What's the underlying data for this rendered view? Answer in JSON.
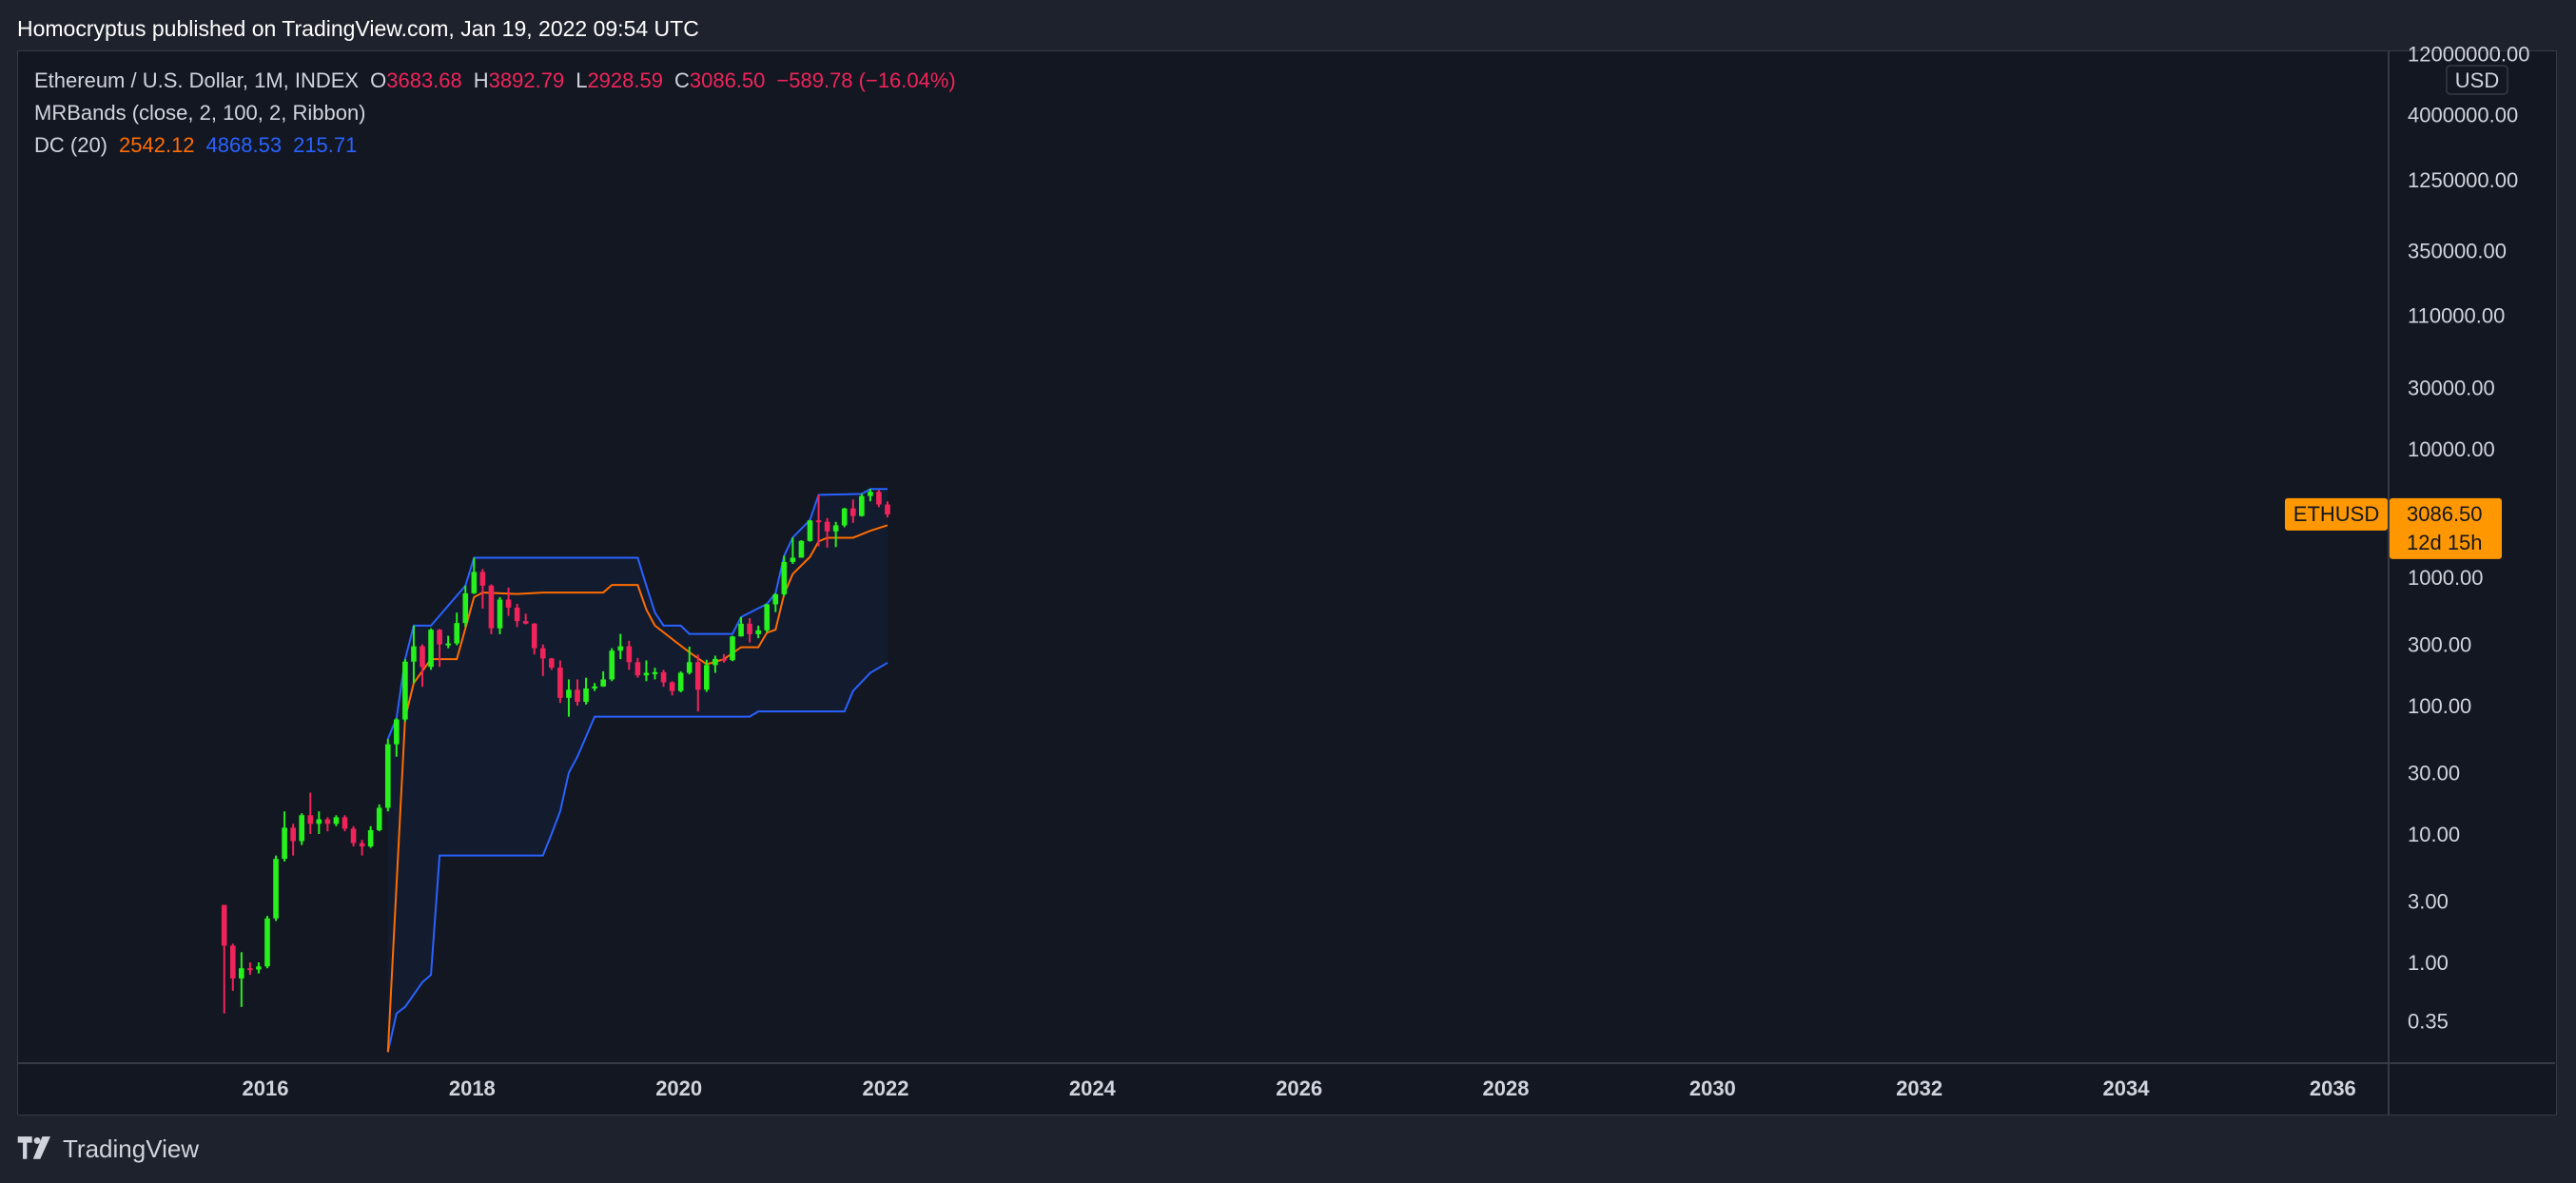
{
  "header": {
    "published": "Homocryptus published on TradingView.com, Jan 19, 2022 09:54 UTC"
  },
  "legend": {
    "symbol": "Ethereum / U.S. Dollar, 1M, INDEX",
    "o_label": "O",
    "o_value": "3683.68",
    "h_label": "H",
    "h_value": "3892.79",
    "l_label": "L",
    "l_value": "2928.59",
    "c_label": "C",
    "c_value": "3086.50",
    "change": "−589.78 (−16.04%)",
    "mrbands": "MRBands (close, 2, 100, 2, Ribbon)",
    "dc_label": "DC (20)",
    "dc_basis": "2542.12",
    "dc_upper": "4868.53",
    "dc_lower": "215.71"
  },
  "price_tag": {
    "symbol": "ETHUSD",
    "price": "3086.50",
    "countdown": "12d 15h"
  },
  "currency": "USD",
  "footer": {
    "brand": "TradingView"
  },
  "colors": {
    "up": "#26f11d",
    "down": "#f0245a",
    "dc_upper_lower": "#2962ff",
    "dc_basis": "#ff6d00",
    "mr_band": "#9c27b0",
    "tag": "#ff9800",
    "bg": "#131722"
  },
  "chart_data": {
    "type": "candlestick",
    "scale": "log",
    "ylim": [
      0.2,
      15000000
    ],
    "xlim": [
      "2014-01-01",
      "2037-01-01"
    ],
    "y_ticks": [
      "12000000.00",
      "4000000.00",
      "1250000.00",
      "350000.00",
      "110000.00",
      "30000.00",
      "10000.00",
      "1000.00",
      "300.00",
      "100.00",
      "30.00",
      "10.00",
      "3.00",
      "1.00",
      "0.35"
    ],
    "y_tick_values": [
      12000000,
      4000000,
      1250000,
      350000,
      110000,
      30000,
      10000,
      1000,
      300,
      100,
      30,
      10,
      3,
      1,
      0.35
    ],
    "x_ticks": [
      "2016",
      "2018",
      "2020",
      "2022",
      "2024",
      "2026",
      "2028",
      "2030",
      "2032",
      "2034",
      "2036"
    ],
    "candles": [
      {
        "t": "2015-08",
        "o": 2.8,
        "h": 2.8,
        "l": 0.4,
        "c": 1.35
      },
      {
        "t": "2015-09",
        "o": 1.35,
        "h": 1.4,
        "l": 0.6,
        "c": 0.75
      },
      {
        "t": "2015-10",
        "o": 0.75,
        "h": 1.2,
        "l": 0.45,
        "c": 0.9
      },
      {
        "t": "2015-11",
        "o": 0.9,
        "h": 1.0,
        "l": 0.8,
        "c": 0.88
      },
      {
        "t": "2015-12",
        "o": 0.88,
        "h": 1.0,
        "l": 0.82,
        "c": 0.93
      },
      {
        "t": "2016-01",
        "o": 0.93,
        "h": 2.3,
        "l": 0.9,
        "c": 2.2
      },
      {
        "t": "2016-02",
        "o": 2.2,
        "h": 6.8,
        "l": 2.1,
        "c": 6.4
      },
      {
        "t": "2016-03",
        "o": 6.4,
        "h": 15.0,
        "l": 6.1,
        "c": 11.2
      },
      {
        "t": "2016-04",
        "o": 11.2,
        "h": 12.0,
        "l": 6.8,
        "c": 8.8
      },
      {
        "t": "2016-05",
        "o": 8.8,
        "h": 14.5,
        "l": 8.2,
        "c": 14.0
      },
      {
        "t": "2016-06",
        "o": 14.0,
        "h": 21.0,
        "l": 10.0,
        "c": 12.0
      },
      {
        "t": "2016-07",
        "o": 12.0,
        "h": 15.0,
        "l": 10.0,
        "c": 13.0
      },
      {
        "t": "2016-08",
        "o": 13.0,
        "h": 13.5,
        "l": 10.5,
        "c": 12.0
      },
      {
        "t": "2016-09",
        "o": 12.0,
        "h": 14.0,
        "l": 11.5,
        "c": 13.5
      },
      {
        "t": "2016-10",
        "o": 13.5,
        "h": 14.0,
        "l": 10.5,
        "c": 11.0
      },
      {
        "t": "2016-11",
        "o": 11.0,
        "h": 11.5,
        "l": 8.0,
        "c": 8.5
      },
      {
        "t": "2016-12",
        "o": 8.5,
        "h": 9.0,
        "l": 6.8,
        "c": 8.0
      },
      {
        "t": "2017-01",
        "o": 8.0,
        "h": 11.5,
        "l": 7.8,
        "c": 10.7
      },
      {
        "t": "2017-02",
        "o": 10.7,
        "h": 17.0,
        "l": 10.5,
        "c": 16.0
      },
      {
        "t": "2017-03",
        "o": 16.0,
        "h": 55.0,
        "l": 15.0,
        "c": 50.0
      },
      {
        "t": "2017-04",
        "o": 50.0,
        "h": 80.0,
        "l": 40.0,
        "c": 78.0
      },
      {
        "t": "2017-05",
        "o": 78.0,
        "h": 230.0,
        "l": 75.0,
        "c": 220.0
      },
      {
        "t": "2017-06",
        "o": 220.0,
        "h": 420.0,
        "l": 150.0,
        "c": 290.0
      },
      {
        "t": "2017-07",
        "o": 290.0,
        "h": 300.0,
        "l": 140.0,
        "c": 200.0
      },
      {
        "t": "2017-08",
        "o": 200.0,
        "h": 400.0,
        "l": 190.0,
        "c": 390.0
      },
      {
        "t": "2017-09",
        "o": 390.0,
        "h": 395.0,
        "l": 200.0,
        "c": 300.0
      },
      {
        "t": "2017-10",
        "o": 300.0,
        "h": 350.0,
        "l": 280.0,
        "c": 305.0
      },
      {
        "t": "2017-11",
        "o": 305.0,
        "h": 530.0,
        "l": 295.0,
        "c": 440.0
      },
      {
        "t": "2017-12",
        "o": 440.0,
        "h": 860.0,
        "l": 410.0,
        "c": 750.0
      },
      {
        "t": "2018-01",
        "o": 750.0,
        "h": 1420.0,
        "l": 740.0,
        "c": 1100.0
      },
      {
        "t": "2018-02",
        "o": 1100.0,
        "h": 1160.0,
        "l": 570.0,
        "c": 860.0
      },
      {
        "t": "2018-03",
        "o": 860.0,
        "h": 880.0,
        "l": 360.0,
        "c": 400.0
      },
      {
        "t": "2018-04",
        "o": 400.0,
        "h": 700.0,
        "l": 360.0,
        "c": 670.0
      },
      {
        "t": "2018-05",
        "o": 670.0,
        "h": 830.0,
        "l": 500.0,
        "c": 580.0
      },
      {
        "t": "2018-06",
        "o": 580.0,
        "h": 620.0,
        "l": 410.0,
        "c": 455.0
      },
      {
        "t": "2018-07",
        "o": 455.0,
        "h": 520.0,
        "l": 430.0,
        "c": 435.0
      },
      {
        "t": "2018-08",
        "o": 435.0,
        "h": 440.0,
        "l": 250.0,
        "c": 280.0
      },
      {
        "t": "2018-09",
        "o": 280.0,
        "h": 300.0,
        "l": 170.0,
        "c": 233.0
      },
      {
        "t": "2018-10",
        "o": 233.0,
        "h": 235.0,
        "l": 190.0,
        "c": 198.0
      },
      {
        "t": "2018-11",
        "o": 198.0,
        "h": 225.0,
        "l": 105.0,
        "c": 115.0
      },
      {
        "t": "2018-12",
        "o": 115.0,
        "h": 160.0,
        "l": 82.0,
        "c": 133.0
      },
      {
        "t": "2019-01",
        "o": 133.0,
        "h": 160.0,
        "l": 100.0,
        "c": 107.0
      },
      {
        "t": "2019-02",
        "o": 107.0,
        "h": 165.0,
        "l": 102.0,
        "c": 136.0
      },
      {
        "t": "2019-03",
        "o": 136.0,
        "h": 150.0,
        "l": 130.0,
        "c": 141.0
      },
      {
        "t": "2019-04",
        "o": 141.0,
        "h": 185.0,
        "l": 140.0,
        "c": 160.0
      },
      {
        "t": "2019-05",
        "o": 160.0,
        "h": 280.0,
        "l": 155.0,
        "c": 268.0
      },
      {
        "t": "2019-06",
        "o": 268.0,
        "h": 362.0,
        "l": 230.0,
        "c": 290.0
      },
      {
        "t": "2019-07",
        "o": 290.0,
        "h": 320.0,
        "l": 190.0,
        "c": 218.0
      },
      {
        "t": "2019-08",
        "o": 218.0,
        "h": 235.0,
        "l": 165.0,
        "c": 172.0
      },
      {
        "t": "2019-09",
        "o": 172.0,
        "h": 225.0,
        "l": 155.0,
        "c": 180.0
      },
      {
        "t": "2019-10",
        "o": 180.0,
        "h": 197.0,
        "l": 160.0,
        "c": 182.0
      },
      {
        "t": "2019-11",
        "o": 182.0,
        "h": 190.0,
        "l": 140.0,
        "c": 152.0
      },
      {
        "t": "2019-12",
        "o": 152.0,
        "h": 155.0,
        "l": 120.0,
        "c": 130.0
      },
      {
        "t": "2020-01",
        "o": 130.0,
        "h": 185.0,
        "l": 127.0,
        "c": 180.0
      },
      {
        "t": "2020-02",
        "o": 180.0,
        "h": 288.0,
        "l": 175.0,
        "c": 218.0
      },
      {
        "t": "2020-03",
        "o": 218.0,
        "h": 250.0,
        "l": 90.0,
        "c": 133.0
      },
      {
        "t": "2020-04",
        "o": 133.0,
        "h": 228.0,
        "l": 128.0,
        "c": 207.0
      },
      {
        "t": "2020-05",
        "o": 207.0,
        "h": 245.0,
        "l": 180.0,
        "c": 231.0
      },
      {
        "t": "2020-06",
        "o": 231.0,
        "h": 252.0,
        "l": 216.0,
        "c": 226.0
      },
      {
        "t": "2020-07",
        "o": 226.0,
        "h": 350.0,
        "l": 222.0,
        "c": 346.0
      },
      {
        "t": "2020-08",
        "o": 346.0,
        "h": 490.0,
        "l": 345.0,
        "c": 435.0
      },
      {
        "t": "2020-09",
        "o": 435.0,
        "h": 480.0,
        "l": 310.0,
        "c": 360.0
      },
      {
        "t": "2020-10",
        "o": 360.0,
        "h": 420.0,
        "l": 335.0,
        "c": 386.0
      },
      {
        "t": "2020-11",
        "o": 386.0,
        "h": 620.0,
        "l": 372.0,
        "c": 615.0
      },
      {
        "t": "2020-12",
        "o": 615.0,
        "h": 750.0,
        "l": 535.0,
        "c": 737.0
      },
      {
        "t": "2021-01",
        "o": 737.0,
        "h": 1470.0,
        "l": 714.0,
        "c": 1315.0
      },
      {
        "t": "2021-02",
        "o": 1315.0,
        "h": 2040.0,
        "l": 1270.0,
        "c": 1420.0
      },
      {
        "t": "2021-03",
        "o": 1420.0,
        "h": 1945.0,
        "l": 1430.0,
        "c": 1918.0
      },
      {
        "t": "2021-04",
        "o": 1918.0,
        "h": 2790.0,
        "l": 1890.0,
        "c": 2772.0
      },
      {
        "t": "2021-05",
        "o": 2772.0,
        "h": 4380.0,
        "l": 1740.0,
        "c": 2706.0
      },
      {
        "t": "2021-06",
        "o": 2706.0,
        "h": 2890.0,
        "l": 1700.0,
        "c": 2275.0
      },
      {
        "t": "2021-07",
        "o": 2275.0,
        "h": 2700.0,
        "l": 1718.0,
        "c": 2535.0
      },
      {
        "t": "2021-08",
        "o": 2535.0,
        "h": 3470.0,
        "l": 2450.0,
        "c": 3433.0
      },
      {
        "t": "2021-09",
        "o": 3433.0,
        "h": 4030.0,
        "l": 2650.0,
        "c": 3000.0
      },
      {
        "t": "2021-10",
        "o": 3000.0,
        "h": 4460.0,
        "l": 2970.0,
        "c": 4288.0
      },
      {
        "t": "2021-11",
        "o": 4288.0,
        "h": 4868.0,
        "l": 3900.0,
        "c": 4631.0
      },
      {
        "t": "2021-12",
        "o": 4631.0,
        "h": 4778.0,
        "l": 3520.0,
        "c": 3683.0
      },
      {
        "t": "2022-01",
        "o": 3683.68,
        "h": 3892.79,
        "l": 2928.59,
        "c": 3086.5
      }
    ],
    "dc_upper": [
      [
        "2017-03",
        55
      ],
      [
        "2017-04",
        80
      ],
      [
        "2017-05",
        230
      ],
      [
        "2017-06",
        420
      ],
      [
        "2017-08",
        420
      ],
      [
        "2017-12",
        860
      ],
      [
        "2018-01",
        1420
      ],
      [
        "2019-08",
        1420
      ],
      [
        "2019-09",
        860
      ],
      [
        "2019-10",
        530
      ],
      [
        "2019-11",
        420
      ],
      [
        "2020-01",
        420
      ],
      [
        "2020-02",
        362
      ],
      [
        "2020-07",
        362
      ],
      [
        "2020-08",
        490
      ],
      [
        "2020-11",
        620
      ],
      [
        "2020-12",
        750
      ],
      [
        "2021-01",
        1470
      ],
      [
        "2021-02",
        2040
      ],
      [
        "2021-04",
        2790
      ],
      [
        "2021-05",
        4380
      ],
      [
        "2021-10",
        4460
      ],
      [
        "2021-11",
        4868
      ],
      [
        "2022-01",
        4868
      ]
    ],
    "dc_lower": [
      [
        "2017-03",
        0.2
      ],
      [
        "2017-04",
        0.4
      ],
      [
        "2017-05",
        0.45
      ],
      [
        "2017-07",
        0.7
      ],
      [
        "2017-08",
        0.8
      ],
      [
        "2017-09",
        6.8
      ],
      [
        "2018-09",
        6.8
      ],
      [
        "2018-10",
        10
      ],
      [
        "2018-11",
        15
      ],
      [
        "2018-12",
        30
      ],
      [
        "2019-01",
        40
      ],
      [
        "2019-03",
        82
      ],
      [
        "2020-09",
        82
      ],
      [
        "2020-10",
        90
      ],
      [
        "2021-08",
        90
      ],
      [
        "2021-09",
        130
      ],
      [
        "2021-11",
        180
      ],
      [
        "2022-01",
        215.71
      ]
    ],
    "dc_basis": [
      [
        "2017-03",
        0.2
      ],
      [
        "2017-05",
        80
      ],
      [
        "2017-06",
        150
      ],
      [
        "2017-08",
        230
      ],
      [
        "2017-11",
        230
      ],
      [
        "2017-12",
        400
      ],
      [
        "2018-01",
        700
      ],
      [
        "2018-02",
        760
      ],
      [
        "2018-06",
        740
      ],
      [
        "2018-09",
        760
      ],
      [
        "2019-04",
        760
      ],
      [
        "2019-05",
        870
      ],
      [
        "2019-08",
        870
      ],
      [
        "2019-09",
        560
      ],
      [
        "2019-10",
        420
      ],
      [
        "2019-12",
        330
      ],
      [
        "2020-02",
        260
      ],
      [
        "2020-04",
        210
      ],
      [
        "2020-06",
        230
      ],
      [
        "2020-08",
        285
      ],
      [
        "2020-10",
        285
      ],
      [
        "2020-11",
        370
      ],
      [
        "2020-12",
        390
      ],
      [
        "2021-01",
        740
      ],
      [
        "2021-02",
        1060
      ],
      [
        "2021-04",
        1440
      ],
      [
        "2021-05",
        1900
      ],
      [
        "2021-06",
        2030
      ],
      [
        "2021-09",
        2030
      ],
      [
        "2021-11",
        2300
      ],
      [
        "2022-01",
        2542.12
      ]
    ]
  }
}
